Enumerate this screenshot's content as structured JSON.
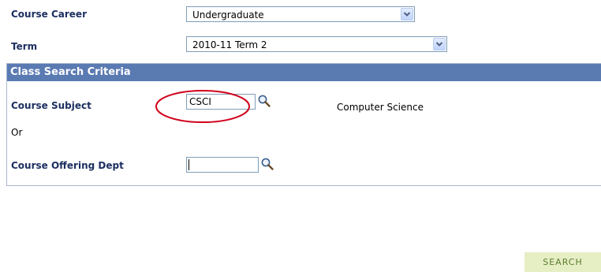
{
  "course_career": {
    "label": "Course Career",
    "value": "Undergraduate"
  },
  "term": {
    "label": "Term",
    "value": "2010-11 Term 2"
  },
  "criteria": {
    "title": "Class Search Criteria",
    "course_subject": {
      "label": "Course Subject",
      "value": "CSCI",
      "description": "Computer Science"
    },
    "or_text": "Or",
    "course_offering_dept": {
      "label": "Course Offering Dept",
      "value": ""
    }
  },
  "search_button": {
    "label": "SEARCH"
  },
  "icons": {
    "lookup": "magnifier-icon",
    "dropdown": "chevron-down-icon",
    "annotation": "red-ellipse-highlight"
  },
  "colors": {
    "label": "#1c2f60",
    "header_bg": "#5a7ab2",
    "search_bg": "#e6eec4",
    "search_text": "#5a7d2e",
    "annotation": "#d0021b"
  }
}
